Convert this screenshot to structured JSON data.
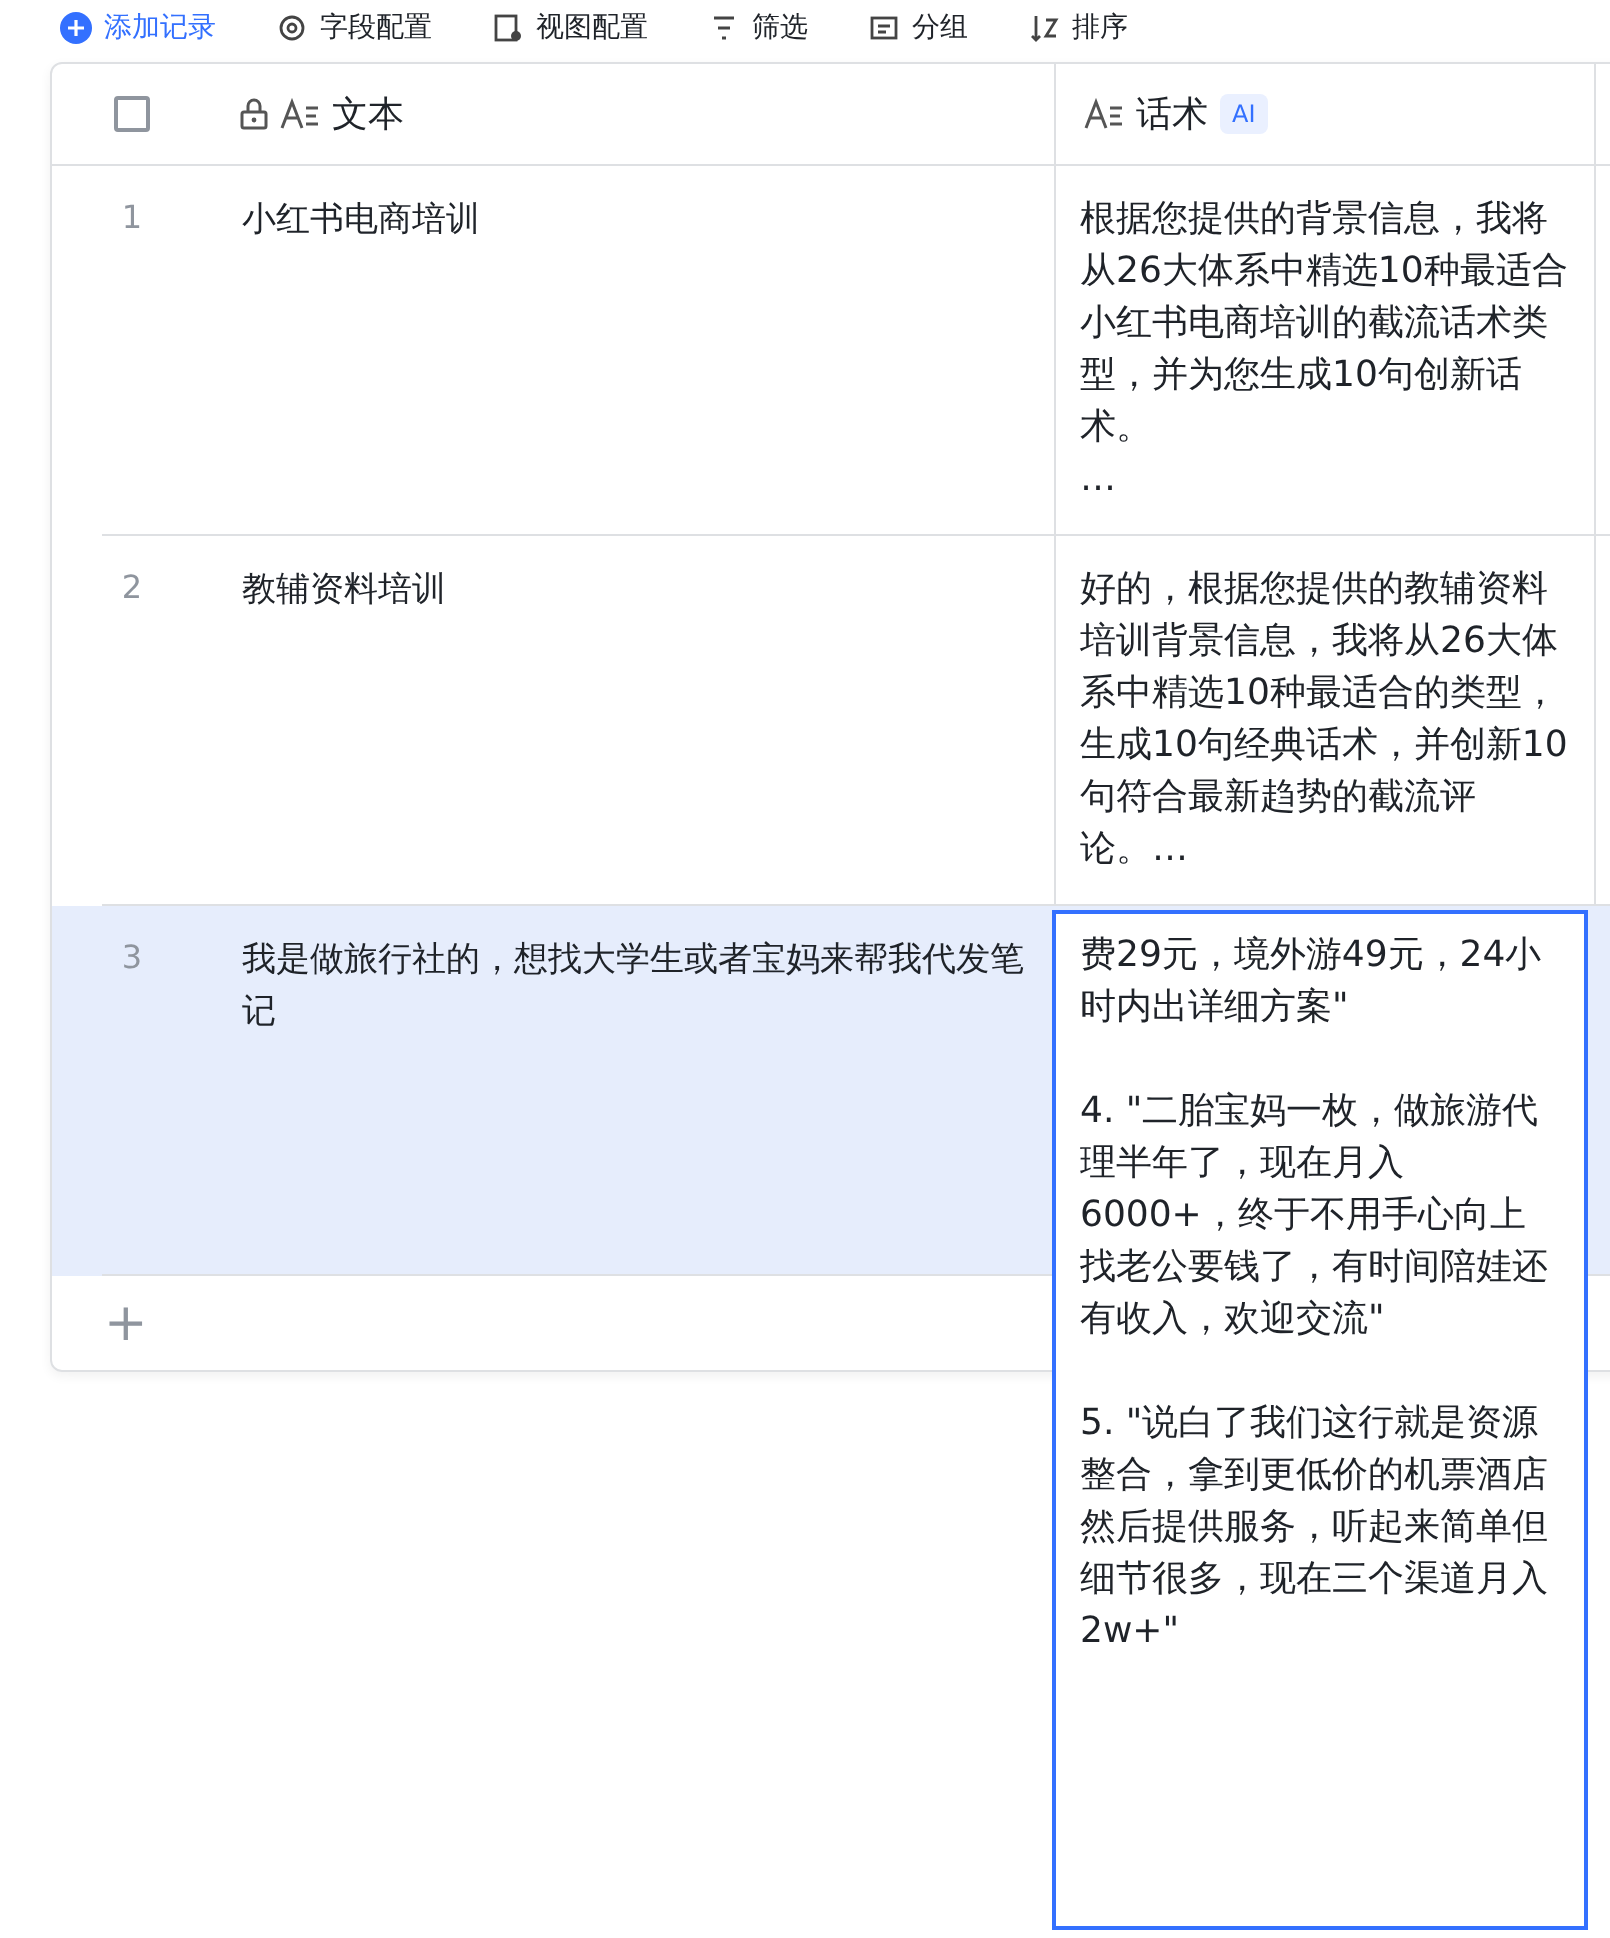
{
  "toolbar": [
    {
      "label": "添加记录",
      "kind": "add"
    },
    {
      "label": "字段配置",
      "kind": "field"
    },
    {
      "label": "视图配置",
      "kind": "view"
    },
    {
      "label": "筛选",
      "kind": "filter"
    },
    {
      "label": "分组",
      "kind": "group"
    },
    {
      "label": "排序",
      "kind": "sort"
    }
  ],
  "table": {
    "header_checkbox": {
      "checked": false
    },
    "columns": [
      {
        "title": "文本",
        "locked": true
      },
      {
        "title": "话术",
        "locked": false,
        "badge": "AI"
      }
    ],
    "rows": [
      {
        "number": "1",
        "text": "小红书电商培训",
        "script": "根据您提供的背景信息，我将从26大体系中精选10种最适合小红书电商培训的截流话术类型，并为您生成10句创新话术。\n…",
        "selected": false,
        "expanded": false
      },
      {
        "number": "2",
        "text": "教辅资料培训",
        "script": "好的，根据您提供的教辅资料培训背景信息，我将从26大体系中精选10种最适合的类型，生成10句经典话术，并创新10句符合最新趋势的截流评论。…",
        "selected": false,
        "expanded": false
      },
      {
        "number": "3",
        "text": "我是做旅行社的，想找大学生或者宝妈来帮我代发笔记",
        "script": "费29元，境外游49元，24小时内出详细方案\"\n\n4. \"二胎宝妈一枚，做旅游代理半年了，现在月入6000+，终于不用手心向上找老公要钱了，有时间陪娃还有收入，欢迎交流\"\n\n5. \"说白了我们这行就是资源整合，拿到更低价的机票酒店然后提供服务，听起来简单但细节很多，现在三个渠道月入2w+\"",
        "selected": true,
        "expanded": true
      }
    ],
    "add_row": {
      "label": "+"
    }
  }
}
